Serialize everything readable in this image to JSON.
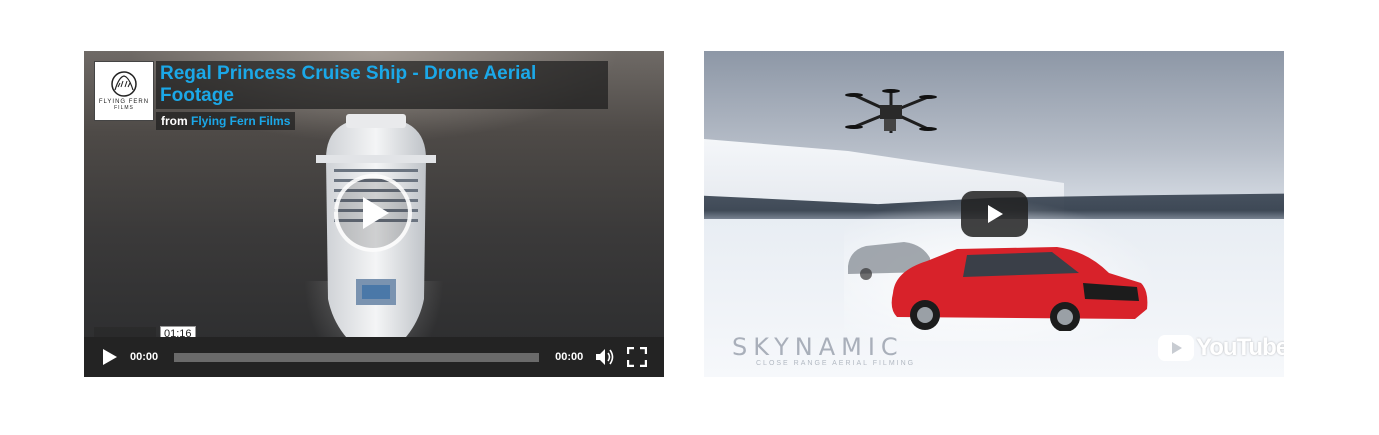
{
  "player1": {
    "title": "Regal Princess Cruise Ship - Drone Aerial Footage",
    "byline_prefix": "from",
    "byline_author": "Flying Fern Films",
    "logo_text": "FLYING FERN",
    "logo_subtext": "FILMS",
    "hover_time": "01:16",
    "current_time": "00:00",
    "duration": "00:00",
    "accent_color": "#1ba8e8"
  },
  "player2": {
    "watermark": "SKYNAMIC",
    "watermark_tagline": "CLOSE RANGE AERIAL FILMING",
    "platform_logo": "YouTube"
  }
}
